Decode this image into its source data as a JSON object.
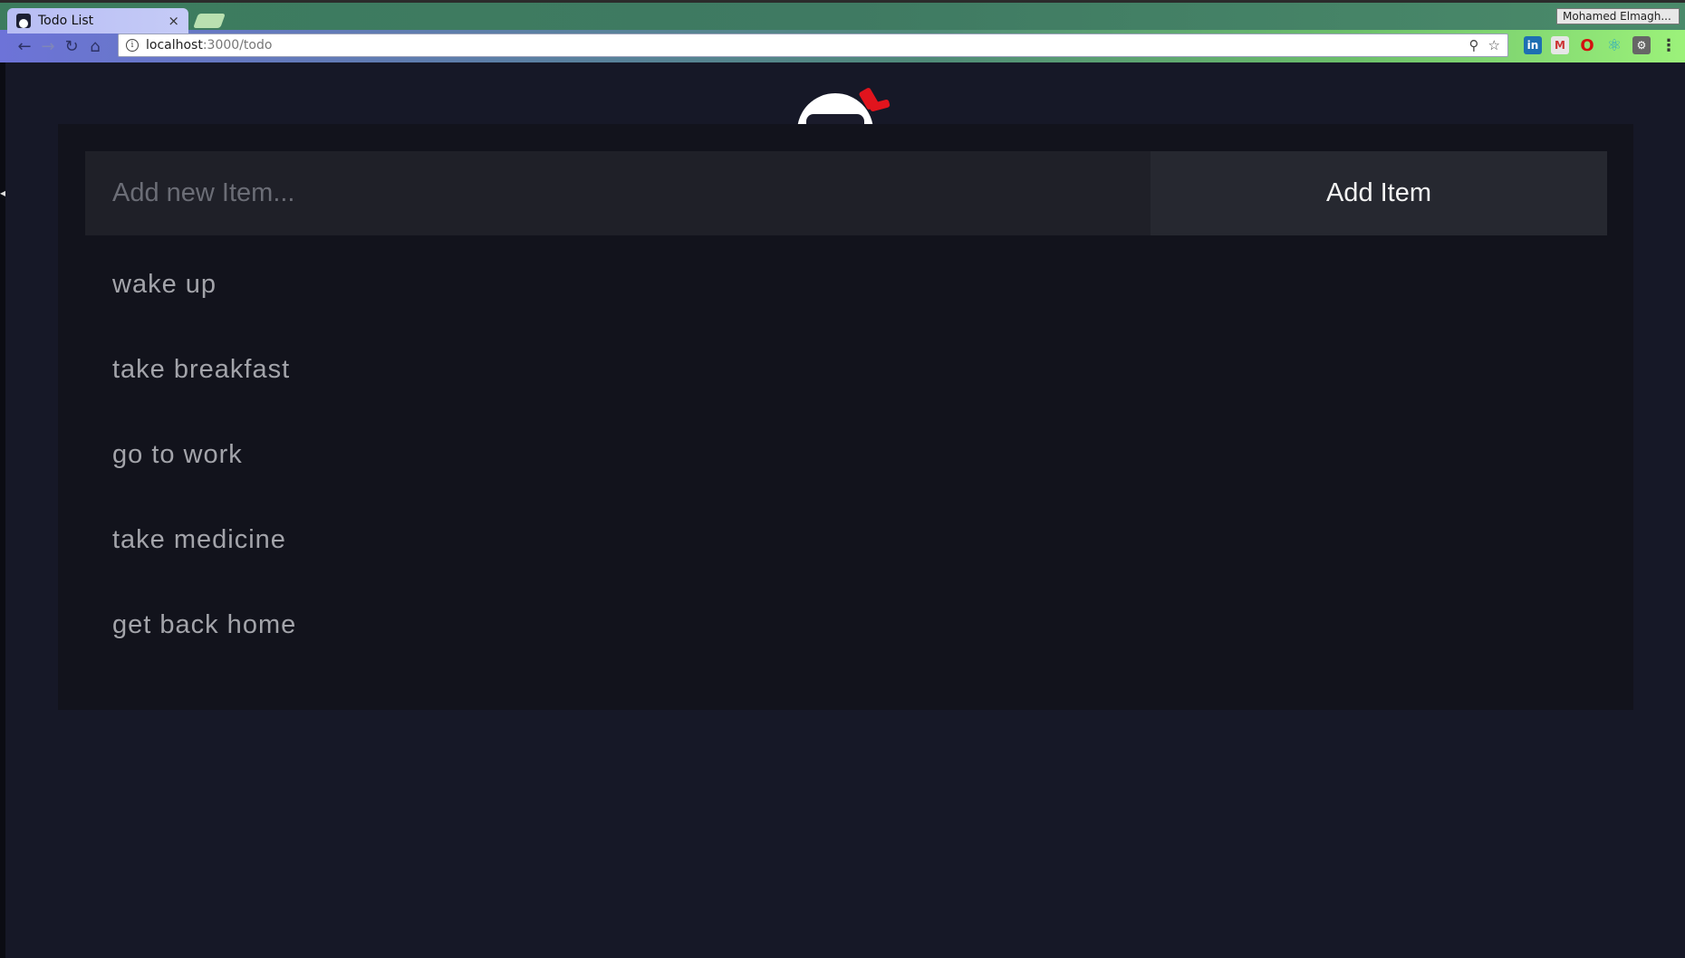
{
  "browser": {
    "tab_title": "Todo List",
    "tab_close": "×",
    "profile_name": "Mohamed Elmagh...",
    "url_host": "localhost",
    "url_path": ":3000/todo",
    "back_icon": "←",
    "forward_icon": "→",
    "reload_icon": "↻",
    "home_icon": "⌂",
    "zoom_icon": "⚲",
    "star_icon": "☆",
    "extensions": [
      {
        "name": "linkedin-icon",
        "glyph": "in"
      },
      {
        "name": "gmail-icon",
        "glyph": "M"
      },
      {
        "name": "opera-icon",
        "glyph": "O"
      },
      {
        "name": "react-icon",
        "glyph": "⚛"
      },
      {
        "name": "settings-extension-icon",
        "glyph": "⚙"
      },
      {
        "name": "menu-icon",
        "glyph": "⋮"
      }
    ]
  },
  "todo": {
    "input_placeholder": "Add new Item...",
    "add_button_label": "Add Item",
    "items": [
      "wake up",
      "take breakfast",
      "go to work",
      "take medicine",
      "get back home"
    ]
  },
  "colors": {
    "page_background": "#161827",
    "card_background": "#12131c",
    "input_background": "#1f2028",
    "button_background": "#262830",
    "item_text": "#a3a4aa",
    "logo_accent": "#e1141d"
  }
}
